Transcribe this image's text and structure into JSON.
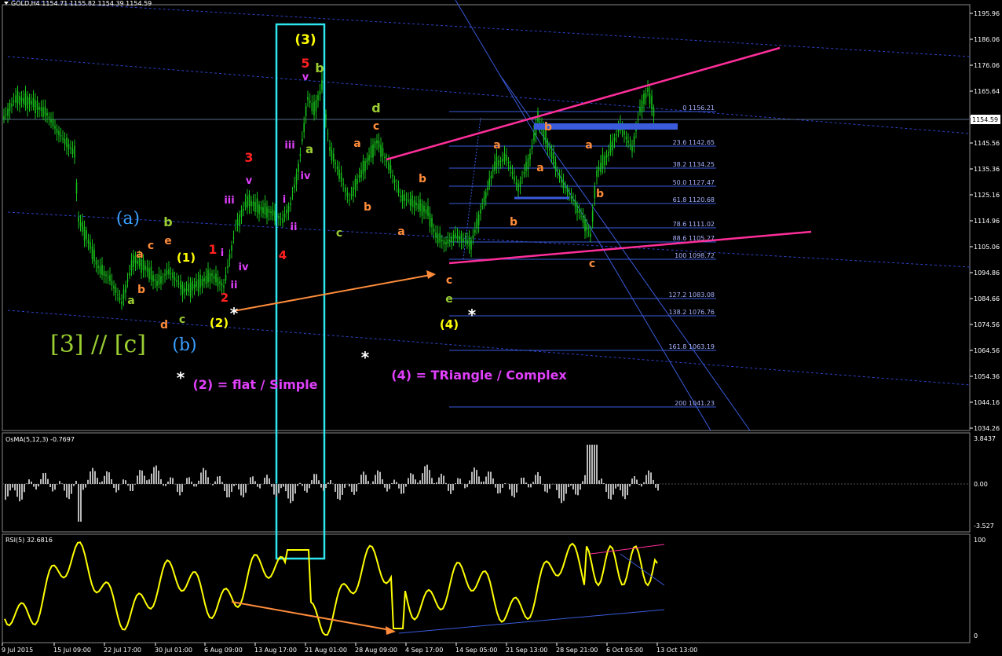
{
  "title_bar": {
    "text": "GOLD,H4  1154.71 1155.82 1154.39 1154.59"
  },
  "main_axis": {
    "ticks": [
      "1195.96",
      "1186.06",
      "1176.06",
      "1165.64",
      "1155.64",
      "1145.56",
      "1135.36",
      "1125.16",
      "1114.96",
      "1105.06",
      "1094.86",
      "1084.66",
      "1074.56",
      "1064.56",
      "1054.36",
      "1044.16",
      "1034.26"
    ],
    "current_price": "1154.59"
  },
  "time_axis": {
    "ticks": [
      "9 Jul 2015",
      "15 Jul 09:00",
      "22 Jul 17:00",
      "30 Jul 01:00",
      "6 Aug 09:00",
      "13 Aug 17:00",
      "21 Aug 01:00",
      "28 Aug 09:00",
      "4 Sep 17:00",
      "14 Sep 05:00",
      "21 Sep 13:00",
      "28 Sep 21:00",
      "6 Oct 05:00",
      "13 Oct 13:00"
    ]
  },
  "fib_levels": [
    {
      "pct": "0",
      "price": "1156.21"
    },
    {
      "pct": "23.6",
      "price": "1142.65"
    },
    {
      "pct": "38.2",
      "price": "1134.25"
    },
    {
      "pct": "50.0",
      "price": "1127.47"
    },
    {
      "pct": "61.8",
      "price": "1120.68"
    },
    {
      "pct": "78.6",
      "price": "1111.02"
    },
    {
      "pct": "88.6",
      "price": "1105.27"
    },
    {
      "pct": "100",
      "price": "1098.72"
    },
    {
      "pct": "127.2",
      "price": "1083.08"
    },
    {
      "pct": "138.2",
      "price": "1076.76"
    },
    {
      "pct": "161.8",
      "price": "1063.19"
    },
    {
      "pct": "200",
      "price": "1041.23"
    }
  ],
  "osma": {
    "label": "OsMA(5,12,3) -0.7697",
    "ticks": [
      "3.8437",
      "0.00",
      "-3.527"
    ]
  },
  "rsi": {
    "label": "RSI(5) 32.6816",
    "ticks": [
      "100",
      "0"
    ]
  },
  "annotations": {
    "wave_3": "(3)",
    "wave_1": "(1)",
    "wave_2": "(2)",
    "wave_4": "(4)",
    "big_a": "(a)",
    "big_b": "(b)",
    "degree_label": "[3] // [c]",
    "note_2": "(2) = flat / Simple",
    "note_4": "(4) = TRiangle / Complex",
    "star": "*"
  },
  "colors": {
    "candle": "#16c21a",
    "fib": "#3a5bdc",
    "pink": "#ff2e9a",
    "cyan": "#2ee6ee",
    "orange": "#ff8c3a",
    "yellow": "#ffff00",
    "olive": "#9acd32",
    "magenta": "#e040fb",
    "red": "#ff2020",
    "blue_big": "#3aa0ff"
  },
  "chart_data": [
    {
      "type": "candlestick",
      "title": "GOLD,H4",
      "x": [
        "9 Jul 2015",
        "15 Jul 09:00",
        "22 Jul 17:00",
        "30 Jul 01:00",
        "6 Aug 09:00",
        "13 Aug 17:00",
        "21 Aug 01:00",
        "28 Aug 09:00",
        "4 Sep 17:00",
        "14 Sep 05:00",
        "21 Sep 13:00",
        "28 Sep 21:00",
        "6 Oct 05:00",
        "13 Oct 13:00"
      ],
      "y_approx_close": [
        1160,
        1150,
        1095,
        1090,
        1095,
        1120,
        1165,
        1135,
        1120,
        1105,
        1150,
        1130,
        1145,
        1154.59
      ],
      "ylim": [
        1034.26,
        1195.96
      ]
    },
    {
      "type": "bar",
      "title": "OsMA(5,12,3)",
      "last": -0.7697,
      "ylim": [
        -3.527,
        3.8437
      ]
    },
    {
      "type": "line",
      "title": "RSI(5)",
      "last": 32.6816,
      "ylim": [
        0,
        100
      ]
    }
  ]
}
